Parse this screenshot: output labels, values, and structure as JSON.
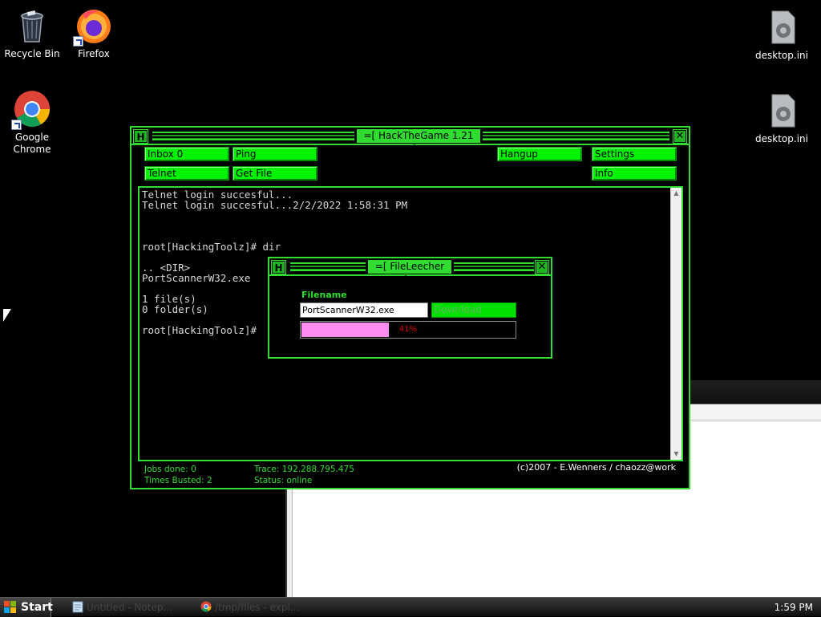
{
  "desktop": {
    "icons": [
      {
        "label": "Recycle Bin",
        "icon": "recycle-bin-icon"
      },
      {
        "label": "Firefox",
        "icon": "firefox-icon"
      },
      {
        "label": "Google Chrome",
        "icon": "chrome-icon"
      },
      {
        "label": "desktop.ini",
        "icon": "settings-file-icon"
      },
      {
        "label": "desktop.ini",
        "icon": "settings-file-icon"
      }
    ]
  },
  "htg": {
    "title": "=[ HackTheGame 1.21 ]=",
    "buttons": {
      "inbox": "Inbox 0",
      "ping": "Ping",
      "hangup": "Hangup",
      "settings": "Settings",
      "telnet": "Telnet",
      "getfile": "Get File",
      "info": "Info"
    },
    "terminal": "Telnet login succesful...\nTelnet login succesful...2/2/2022 1:58:31 PM\n\n\n\nroot[HackingToolz]# dir\n\n.. <DIR>\nPortScannerW32.exe\n\n1 file(s)\n0 folder(s)\n\nroot[HackingToolz]#",
    "status": {
      "jobs": "Jobs done: 0",
      "busted": "Times Busted: 2",
      "trace": "Trace: 192.288.795.475",
      "state": "Status: online",
      "credit": "(c)2007 - E.Wenners / chaozz@work"
    }
  },
  "leecher": {
    "title": "=[ FileLeecher ]=",
    "filename_label": "Filename",
    "filename_value": "PortScannerW32.exe",
    "download_label": "Download",
    "progress": 0.41,
    "progress_text": "41%"
  },
  "taskbar": {
    "start": "Start",
    "tasks": [
      {
        "label": "Untitled - Notep...",
        "icon": "notepad-icon"
      },
      {
        "label": "/tmp/files - expl...",
        "icon": "chrome-icon"
      }
    ],
    "clock": "1:59 PM"
  },
  "colors": {
    "accent": "#2fdc2f",
    "button": "#00f200",
    "progress_fill": "#ff8cf0"
  }
}
